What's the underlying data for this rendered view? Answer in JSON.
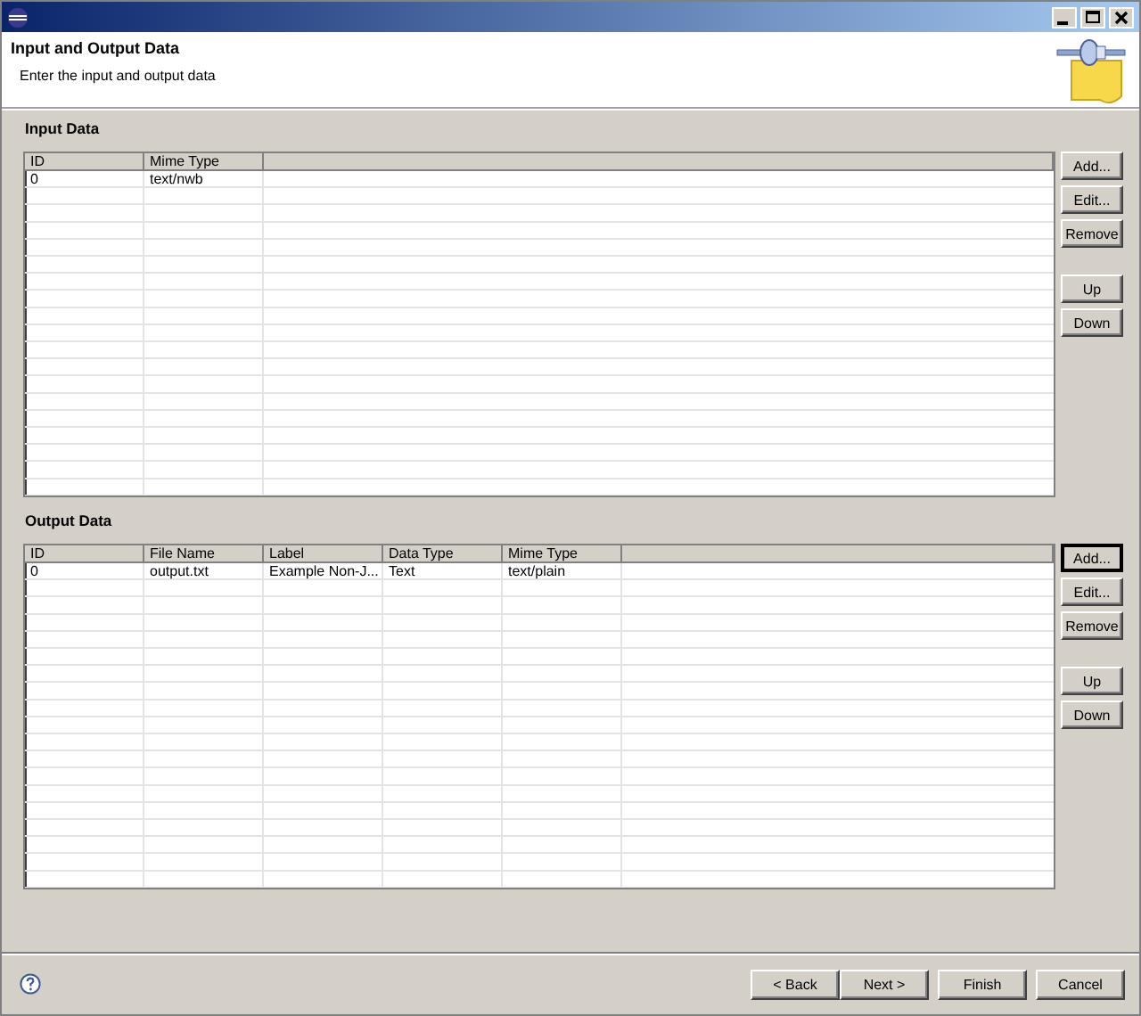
{
  "header": {
    "title": "Input and Output Data",
    "subtitle": "Enter the input and output data"
  },
  "sections": [
    {
      "title": "Input Data",
      "columns": [
        "ID",
        "Mime Type"
      ],
      "rows": [
        [
          "0",
          "text/nwb"
        ]
      ],
      "edit_buttons": [
        {
          "label": "Add...",
          "focused": false
        },
        {
          "label": "Edit...",
          "focused": false
        },
        {
          "label": "Remove",
          "focused": false
        }
      ],
      "move_buttons": [
        {
          "label": "Up",
          "focused": false
        },
        {
          "label": "Down",
          "focused": false
        }
      ]
    },
    {
      "title": "Output Data",
      "columns": [
        "ID",
        "File Name",
        "Label",
        "Data Type",
        "Mime Type"
      ],
      "rows": [
        [
          "0",
          "output.txt",
          "Example Non-J...",
          "Text",
          "text/plain"
        ]
      ],
      "edit_buttons": [
        {
          "label": "Add...",
          "focused": true
        },
        {
          "label": "Edit...",
          "focused": false
        },
        {
          "label": "Remove",
          "focused": false
        }
      ],
      "move_buttons": [
        {
          "label": "Up",
          "focused": false
        },
        {
          "label": "Down",
          "focused": false
        }
      ]
    }
  ],
  "footer": {
    "buttons": [
      "< Back",
      "Next >",
      "Finish",
      "Cancel"
    ]
  }
}
